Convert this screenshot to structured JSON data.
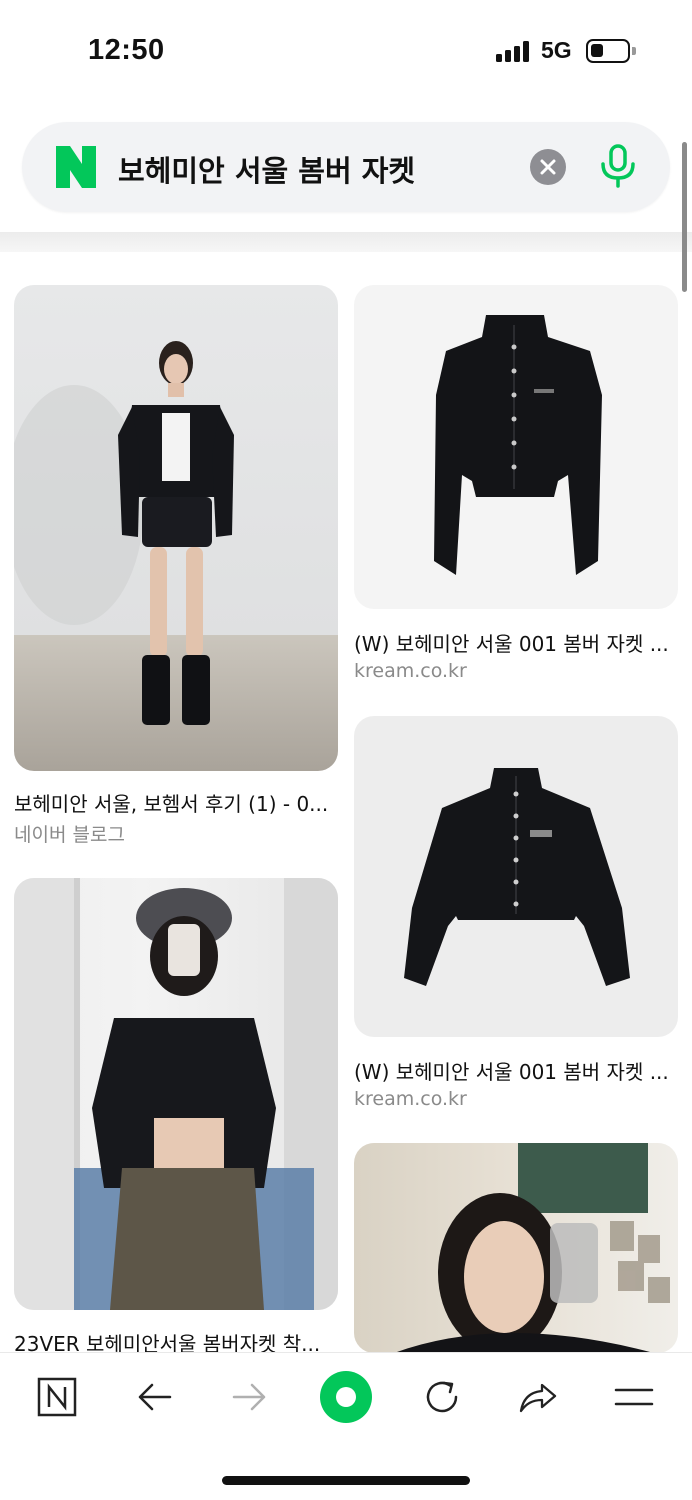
{
  "status": {
    "time": "12:50",
    "network": "5G"
  },
  "search": {
    "query": "보헤미안 서울 봄버 자켓",
    "brand_color": "#03c75a"
  },
  "results": [
    {
      "caption": "보헤미안 서울, 보헴서 후기 (1) - 0...",
      "source": "네이버 블로그"
    },
    {
      "caption": "(W) 보헤미안 서울 001 봄버 자켓 ...",
      "source": "kream.co.kr"
    },
    {
      "caption": "(W) 보헤미안 서울 001 봄버 자켓 ...",
      "source": "kream.co.kr"
    },
    {
      "caption": "23VER 보헤미안서울 봄버자켓 착..."
    }
  ],
  "icons": {
    "logo": "naver-n-icon",
    "clear": "clear-icon",
    "mic": "microphone-icon",
    "toolbar": [
      "naver-home-icon",
      "back-arrow-icon",
      "forward-arrow-icon",
      "green-dot-icon",
      "reload-icon",
      "share-icon",
      "menu-icon"
    ]
  }
}
